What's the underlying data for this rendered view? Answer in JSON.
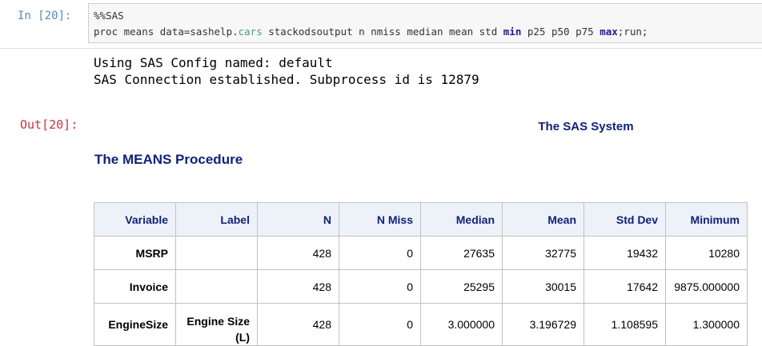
{
  "input_cell": {
    "prompt": "In [20]:",
    "magic": "%%SAS",
    "code_parts": [
      {
        "text": "proc means data=sashelp.",
        "cls": ""
      },
      {
        "text": "cars",
        "cls": "lib"
      },
      {
        "text": " stackodsoutput n nmiss median mean std ",
        "cls": ""
      },
      {
        "text": "min",
        "cls": "kw"
      },
      {
        "text": " p25 p50 p75 ",
        "cls": ""
      },
      {
        "text": "max",
        "cls": "kw"
      },
      {
        "text": ";run;",
        "cls": ""
      }
    ]
  },
  "stdout": {
    "line1": "Using SAS Config named: default",
    "line2": "SAS Connection established. Subprocess id is 12879"
  },
  "output_cell": {
    "prompt": "Out[20]:",
    "system_title": "The SAS System",
    "procedure_title": "The MEANS Procedure"
  },
  "table": {
    "columns": [
      "Variable",
      "Label",
      "N",
      "N Miss",
      "Median",
      "Mean",
      "Std Dev",
      "Minimum"
    ],
    "rows": [
      [
        "MSRP",
        "",
        "428",
        "0",
        "27635",
        "32775",
        "19432",
        "10280"
      ],
      [
        "Invoice",
        "",
        "428",
        "0",
        "25295",
        "30015",
        "17642",
        "9875.000000"
      ],
      [
        "EngineSize",
        "Engine Size (L)",
        "428",
        "0",
        "3.000000",
        "3.196729",
        "1.108595",
        "1.300000"
      ]
    ]
  }
}
